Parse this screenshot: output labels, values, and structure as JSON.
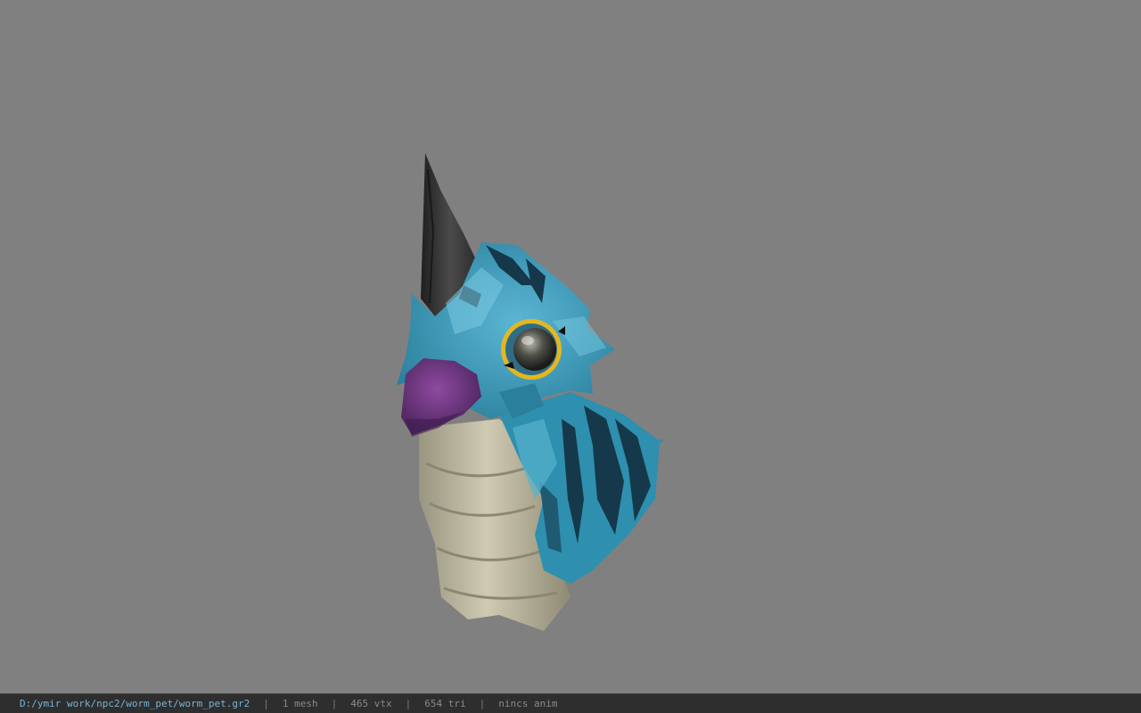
{
  "viewport": {
    "background_color": "#808080",
    "model": {
      "colors": {
        "feather_blue": "#3a9fbd",
        "feather_dark": "#1c4f63",
        "feather_light": "#62bcd6",
        "horn": "#3a3a3a",
        "beak": "#7b3d8c",
        "body": "#bdb89f",
        "eye_ring": "#e3b722"
      }
    }
  },
  "status_bar": {
    "file_path": "D:/ymir work/npc2/worm_pet/worm_pet.gr2",
    "separator": "|",
    "mesh_count": "1 mesh",
    "vertex_count": "465 vtx",
    "triangle_count": "654 tri",
    "anim_status": "nincs anim",
    "path_color": "#76b4d6",
    "text_color": "#8a8a8a"
  }
}
